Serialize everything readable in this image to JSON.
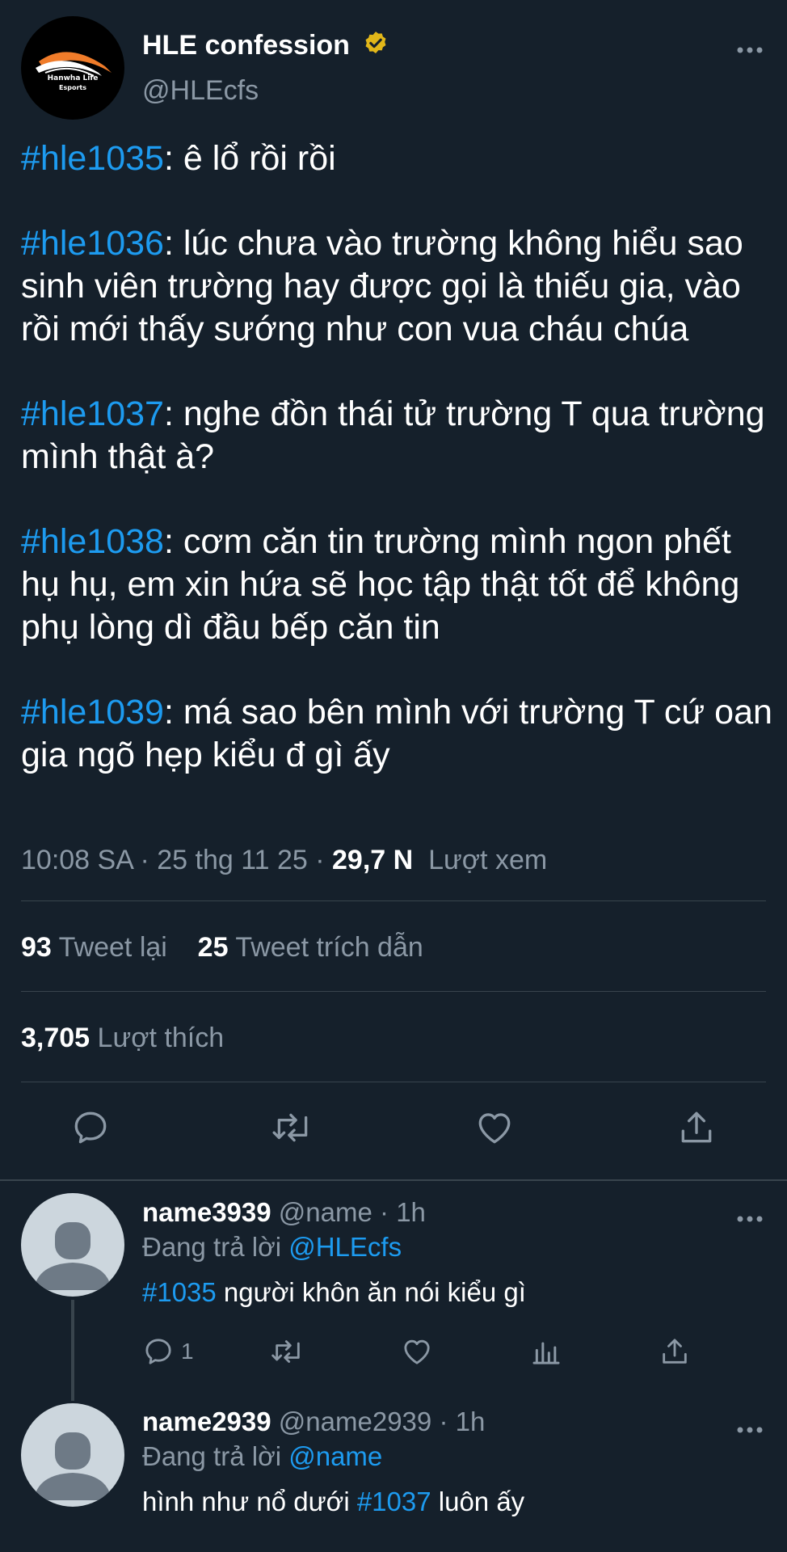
{
  "tweet": {
    "display_name": "HLE confession",
    "handle": "@HLEcfs",
    "avatar_text_1": "Hanwha Life",
    "avatar_text_2": "Esports",
    "paragraphs": [
      {
        "tag": "#hle1035",
        "text": ": ê lổ rồi rồi"
      },
      {
        "tag": "#hle1036",
        "text": ": lúc chưa vào trường không hiểu sao sinh viên trường hay được gọi là thiếu gia, vào rồi mới thấy sướng như con vua cháu chúa"
      },
      {
        "tag": "#hle1037",
        "text": ": nghe đồn thái tử trường T qua trường mình thật à?"
      },
      {
        "tag": "#hle1038",
        "text": ": cơm căn tin trường mình ngon phết hụ hụ, em xin hứa sẽ học tập thật tốt để không phụ lòng dì đầu bếp căn tin"
      },
      {
        "tag": "#hle1039",
        "text": ": má sao bên mình với trường T cứ oan gia ngõ hẹp kiểu đ gì ấy"
      }
    ],
    "time": "10:08 SA",
    "date": "25 thg 11 25",
    "views_count": "29,7 N",
    "views_label": "Lượt xem",
    "retweets_count": "93",
    "retweets_label": "Tweet lại",
    "quotes_count": "25",
    "quotes_label": "Tweet trích dẫn",
    "likes_count": "3,705",
    "likes_label": "Lượt thích"
  },
  "replies": [
    {
      "name": "name3939",
      "handle": "@name",
      "time": "1h",
      "replying_label": "Đang trả lời",
      "replying_to": "@HLEcfs",
      "tag": "#1035",
      "text_before": "",
      "text_after": " người khôn ăn nói kiểu gì",
      "reply_count": "1"
    },
    {
      "name": "name2939",
      "handle": "@name2939",
      "time": "1h",
      "replying_label": "Đang trả lời",
      "replying_to": "@name",
      "text_before": "hình như nổ dưới ",
      "tag": "#1037",
      "text_after": " luôn ấy"
    }
  ],
  "colors": {
    "background": "#15202b",
    "link": "#1d9bf0",
    "secondary_text": "#8b98a5",
    "divider": "#38444d",
    "verified": "#e2b719"
  }
}
